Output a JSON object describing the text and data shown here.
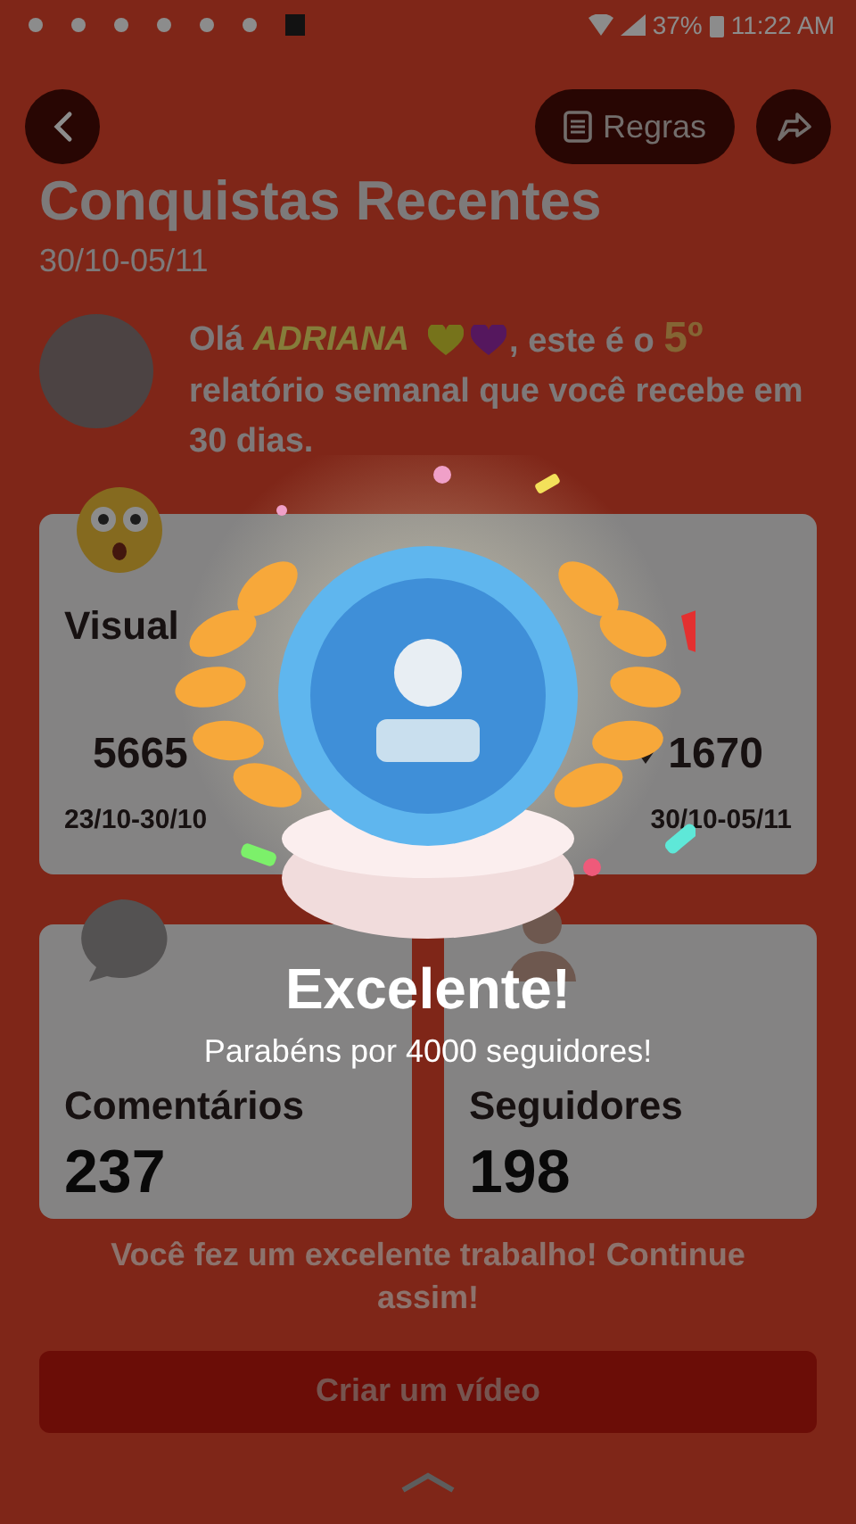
{
  "status_bar": {
    "battery": "37%",
    "time": "11:22 AM"
  },
  "header": {
    "rules_button": "Regras"
  },
  "title": "Conquistas Recentes",
  "period": "30/10-05/11",
  "greeting": {
    "before": "Olá ",
    "name": "ADRIANA",
    "middle": ", este é o ",
    "ordinal": "5º",
    "after": " relatório semanal que você recebe em 30 dias."
  },
  "views_card": {
    "label": "Visual",
    "columns": [
      {
        "value": "5665",
        "period": "23/10-30/10",
        "down": false
      },
      {
        "value": "1670",
        "period": "30/10-05/11",
        "down": true
      }
    ]
  },
  "stat_cards": [
    {
      "label": "Comentários",
      "value": "237",
      "kind": "comments"
    },
    {
      "label": "Seguidores",
      "value": "198",
      "kind": "followers"
    }
  ],
  "message": "Você fez um excelente trabalho! Continue assim!",
  "create_button": "Criar um vídeo",
  "popup": {
    "title": "Excelente!",
    "subtitle": "Parabéns por 4000 seguidores!"
  }
}
